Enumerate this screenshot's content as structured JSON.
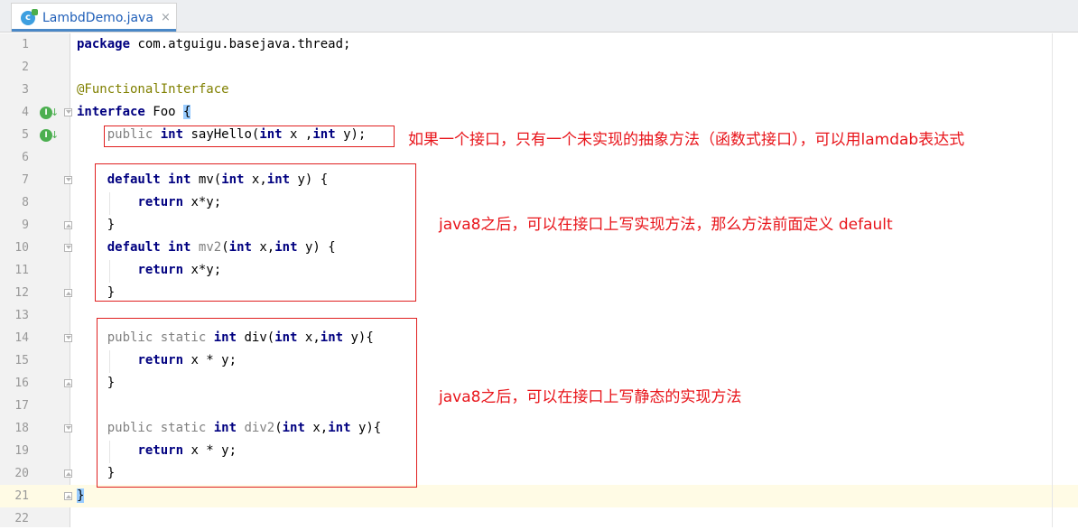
{
  "tab": {
    "icon_letter": "c",
    "title": "LambdDemo.java",
    "close": "×"
  },
  "lines": [
    {
      "n": "1"
    },
    {
      "n": "2"
    },
    {
      "n": "3"
    },
    {
      "n": "4"
    },
    {
      "n": "5"
    },
    {
      "n": "6"
    },
    {
      "n": "7"
    },
    {
      "n": "8"
    },
    {
      "n": "9"
    },
    {
      "n": "10"
    },
    {
      "n": "11"
    },
    {
      "n": "12"
    },
    {
      "n": "13"
    },
    {
      "n": "14"
    },
    {
      "n": "15"
    },
    {
      "n": "16"
    },
    {
      "n": "17"
    },
    {
      "n": "18"
    },
    {
      "n": "19"
    },
    {
      "n": "20"
    },
    {
      "n": "21"
    },
    {
      "n": "22"
    }
  ],
  "code": {
    "l1": [
      {
        "t": "package",
        "c": "kw"
      },
      {
        "t": " com.atguigu.basejava.thread;",
        "c": ""
      }
    ],
    "l3": [
      {
        "t": "@FunctionalInterface",
        "c": "ann"
      }
    ],
    "l4": [
      {
        "t": "interface",
        "c": "kw"
      },
      {
        "t": " Foo ",
        "c": ""
      },
      {
        "t": "{",
        "c": "brace-hl"
      }
    ],
    "l5": [
      {
        "t": "    ",
        "c": ""
      },
      {
        "t": "public",
        "c": "dim"
      },
      {
        "t": " ",
        "c": ""
      },
      {
        "t": "int",
        "c": "kw"
      },
      {
        "t": " sayHello(",
        "c": ""
      },
      {
        "t": "int",
        "c": "kw"
      },
      {
        "t": " x ,",
        "c": ""
      },
      {
        "t": "int",
        "c": "kw"
      },
      {
        "t": " y);",
        "c": ""
      }
    ],
    "l7": [
      {
        "t": "    ",
        "c": ""
      },
      {
        "t": "default",
        "c": "kw"
      },
      {
        "t": " ",
        "c": ""
      },
      {
        "t": "int",
        "c": "kw"
      },
      {
        "t": " mv(",
        "c": ""
      },
      {
        "t": "int",
        "c": "kw"
      },
      {
        "t": " x,",
        "c": ""
      },
      {
        "t": "int",
        "c": "kw"
      },
      {
        "t": " y) {",
        "c": ""
      }
    ],
    "l8": [
      {
        "t": "        ",
        "c": ""
      },
      {
        "t": "return",
        "c": "kw"
      },
      {
        "t": " x*y;",
        "c": ""
      }
    ],
    "l9": [
      {
        "t": "    }",
        "c": ""
      }
    ],
    "l10": [
      {
        "t": "    ",
        "c": ""
      },
      {
        "t": "default",
        "c": "kw"
      },
      {
        "t": " ",
        "c": ""
      },
      {
        "t": "int",
        "c": "kw"
      },
      {
        "t": " ",
        "c": ""
      },
      {
        "t": "mv2",
        "c": "dim"
      },
      {
        "t": "(",
        "c": ""
      },
      {
        "t": "int",
        "c": "kw"
      },
      {
        "t": " x,",
        "c": ""
      },
      {
        "t": "int",
        "c": "kw"
      },
      {
        "t": " y) {",
        "c": ""
      }
    ],
    "l11": [
      {
        "t": "        ",
        "c": ""
      },
      {
        "t": "return",
        "c": "kw"
      },
      {
        "t": " x*y;",
        "c": ""
      }
    ],
    "l12": [
      {
        "t": "    }",
        "c": ""
      }
    ],
    "l14": [
      {
        "t": "    ",
        "c": ""
      },
      {
        "t": "public static",
        "c": "dim"
      },
      {
        "t": " ",
        "c": ""
      },
      {
        "t": "int",
        "c": "kw"
      },
      {
        "t": " div(",
        "c": ""
      },
      {
        "t": "int",
        "c": "kw"
      },
      {
        "t": " x,",
        "c": ""
      },
      {
        "t": "int",
        "c": "kw"
      },
      {
        "t": " y){",
        "c": ""
      }
    ],
    "l15": [
      {
        "t": "        ",
        "c": ""
      },
      {
        "t": "return",
        "c": "kw"
      },
      {
        "t": " x * y;",
        "c": ""
      }
    ],
    "l16": [
      {
        "t": "    }",
        "c": ""
      }
    ],
    "l18": [
      {
        "t": "    ",
        "c": ""
      },
      {
        "t": "public static",
        "c": "dim"
      },
      {
        "t": " ",
        "c": ""
      },
      {
        "t": "int",
        "c": "kw"
      },
      {
        "t": " ",
        "c": ""
      },
      {
        "t": "div2",
        "c": "dim"
      },
      {
        "t": "(",
        "c": ""
      },
      {
        "t": "int",
        "c": "kw"
      },
      {
        "t": " x,",
        "c": ""
      },
      {
        "t": "int",
        "c": "kw"
      },
      {
        "t": " y){",
        "c": ""
      }
    ],
    "l19": [
      {
        "t": "        ",
        "c": ""
      },
      {
        "t": "return",
        "c": "kw"
      },
      {
        "t": " x * y;",
        "c": ""
      }
    ],
    "l20": [
      {
        "t": "    }",
        "c": ""
      }
    ],
    "l21": [
      {
        "t": "}",
        "c": "brace-hl2"
      }
    ]
  },
  "annotations": {
    "note1": "如果一个接口，只有一个未实现的抽象方法（函数式接口），可以用lamdab表达式",
    "note2": "java8之后，可以在接口上写实现方法，那么方法前面定义 default",
    "note3": "java8之后，可以在接口上写静态的实现方法"
  },
  "colors": {
    "annotation_red": "#e8141a",
    "keyword": "#000080",
    "caret_line": "#fffbe5"
  }
}
